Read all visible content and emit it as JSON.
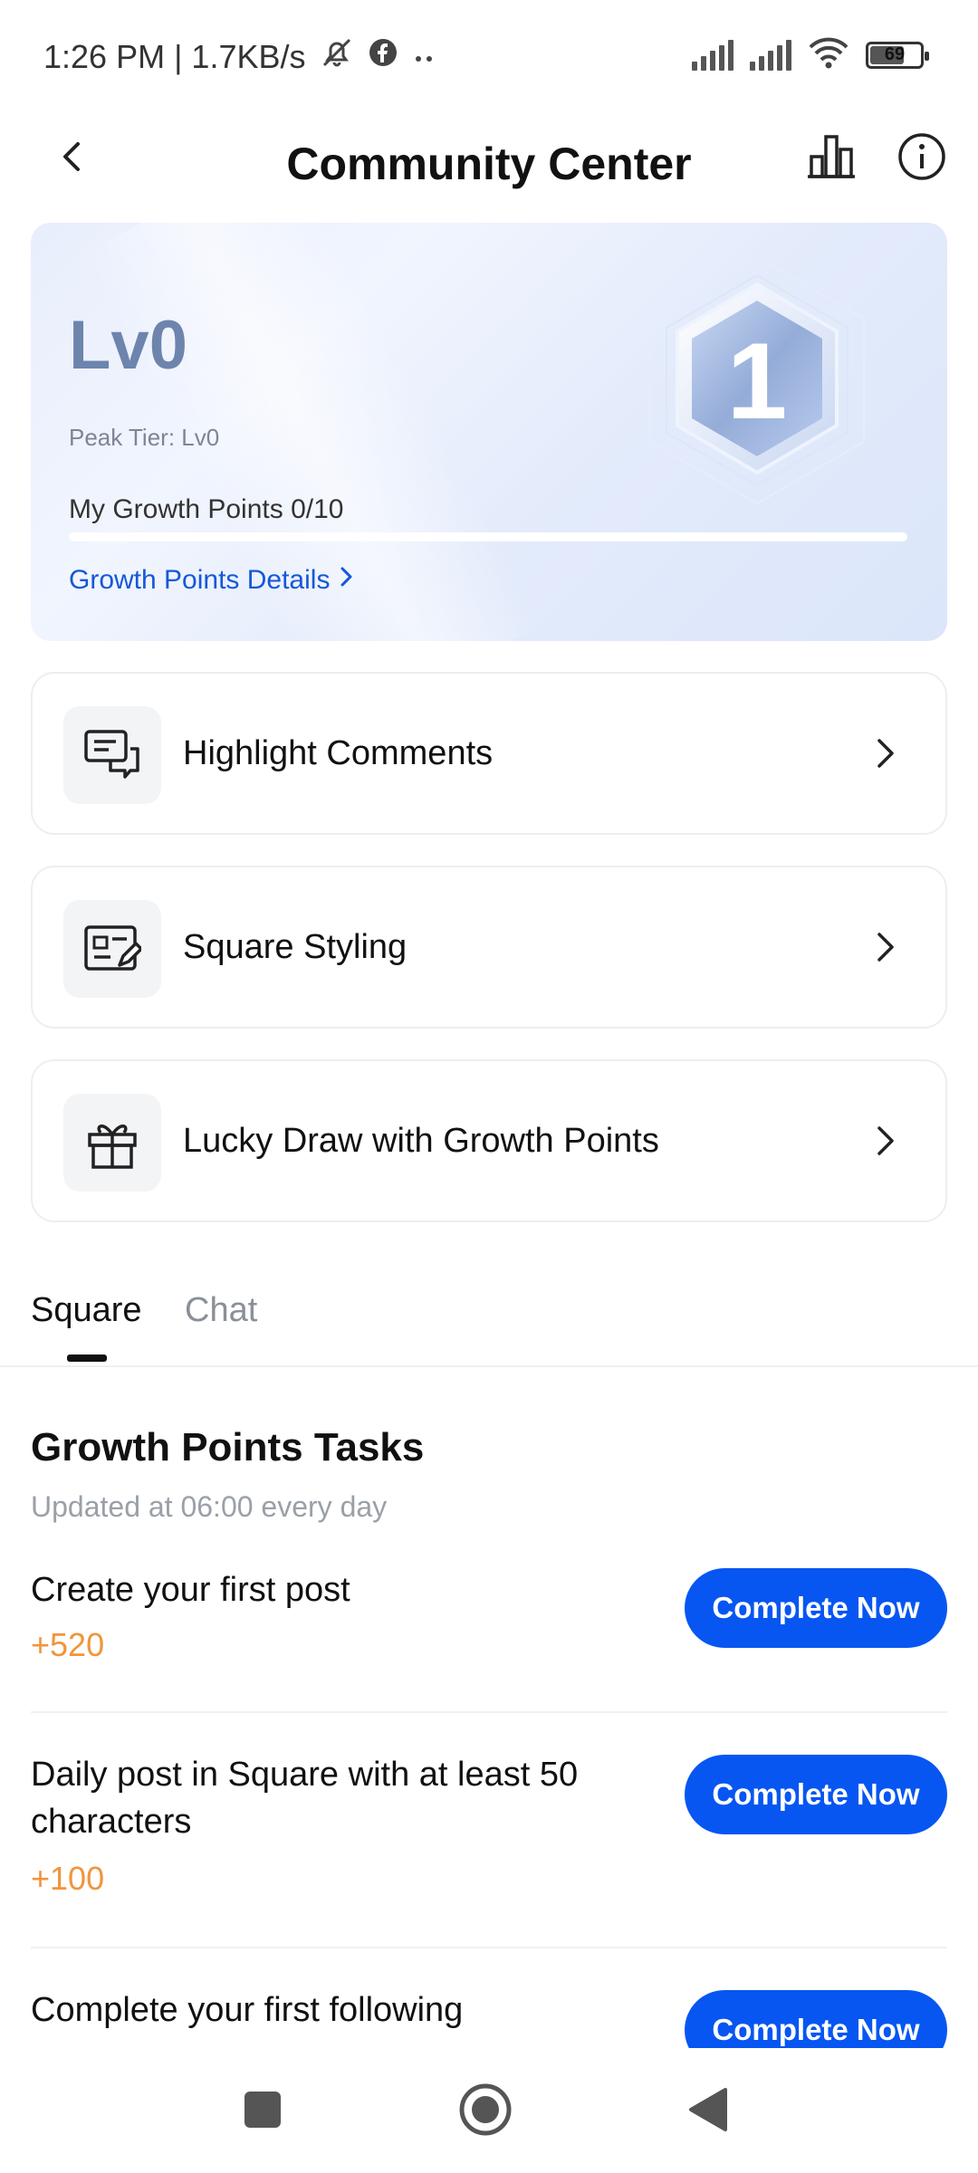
{
  "status_bar": {
    "time_speed": "1:26 PM | 1.7KB/s",
    "battery": "69",
    "battery_level": 0.69,
    "icons": [
      "mute-icon",
      "facebook-icon",
      "more-dots-icon",
      "signal-icon",
      "signal-icon",
      "wifi-icon",
      "battery-icon"
    ]
  },
  "header": {
    "title": "Community Center",
    "icons": [
      "back-arrow-icon",
      "bar-chart-icon",
      "info-icon"
    ]
  },
  "level_card": {
    "level": "Lv0",
    "peak_tier": "Peak Tier: Lv0",
    "growth_points_label": "My Growth Points 0/10",
    "progress_fraction": 0.0,
    "details_link": "Growth Points Details",
    "badge_number": "1"
  },
  "features": [
    {
      "label": "Highlight Comments",
      "icon": "comments-icon"
    },
    {
      "label": "Square Styling",
      "icon": "edit-card-icon"
    },
    {
      "label": "Lucky Draw with Growth Points",
      "icon": "gift-icon"
    }
  ],
  "tabs": [
    {
      "label": "Square",
      "active": true
    },
    {
      "label": "Chat",
      "active": false
    }
  ],
  "tasks_section": {
    "title": "Growth Points Tasks",
    "subtitle": "Updated at 06:00 every day",
    "tasks": [
      {
        "name": "Create your first post",
        "points": "+520",
        "button": "Complete Now"
      },
      {
        "name": "Daily post in Square with at least 50 characters",
        "points": "+100",
        "button": "Complete Now"
      },
      {
        "name": "Complete your first following",
        "points": "",
        "button": "Complete Now"
      }
    ]
  },
  "colors": {
    "accent": "#0756f2",
    "points": "#f0953c",
    "level_text": "#6d84ad"
  }
}
